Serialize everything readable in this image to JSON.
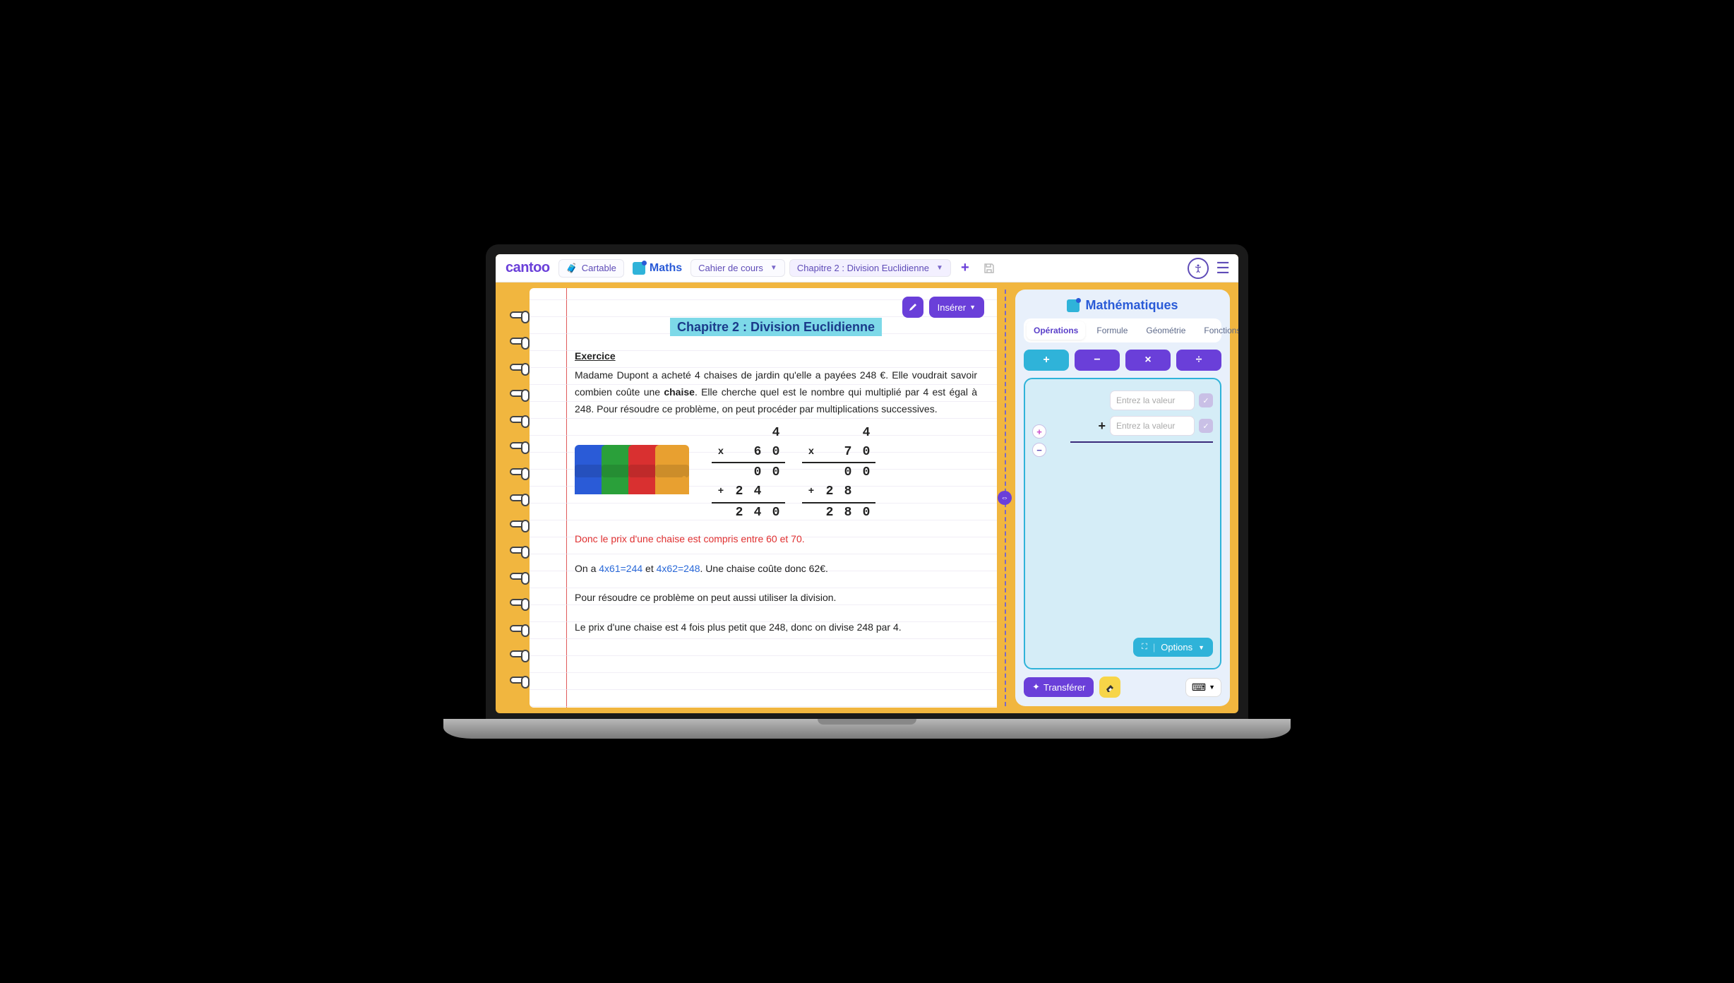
{
  "header": {
    "logo": "cantoo",
    "cartable": "Cartable",
    "subject": "Maths",
    "notebook_dd": "Cahier de cours",
    "chapter_dd": "Chapitre 2 : Division Euclidienne"
  },
  "page": {
    "insert_btn": "Insérer",
    "title": "Chapitre 2 : Division Euclidienne",
    "ex_heading": "Exercice",
    "ex_p1a": "Madame Dupont a acheté 4 chaises de jardin qu'elle a payées 248 €. Elle voudrait savoir combien coûte une ",
    "ex_p1b": "chaise",
    "ex_p1c": ". Elle cherche quel est le nombre qui multiplié par 4 est égal à 248. Pour résoudre ce problème, on peut procéder par multiplications successives.",
    "mult1": {
      "top": "4",
      "m1": "6",
      "m2": "0",
      "r1a": "0",
      "r1b": "0",
      "r2a": "2",
      "r2b": "4",
      "s1": "2",
      "s2": "4",
      "s3": "0"
    },
    "mult2": {
      "top": "4",
      "m1": "7",
      "m2": "0",
      "r1a": "0",
      "r1b": "0",
      "r2a": "2",
      "r2b": "8",
      "s1": "2",
      "s2": "8",
      "s3": "0"
    },
    "red_line": "Donc le prix d'une chaise est compris entre 60 et 70.",
    "line2a": "On a ",
    "link1": "4x61=244",
    "line2b": " et ",
    "link2": "4x62=248",
    "line2c": ". Une chaise coûte donc 62€.",
    "line3": "Pour résoudre ce problème on peut aussi utiliser la division.",
    "line4": "Le prix d'une chaise est 4 fois plus petit que 248, donc on divise 248 par 4."
  },
  "panel": {
    "title": "Mathématiques",
    "tabs": [
      "Opérations",
      "Formule",
      "Géométrie",
      "Fonctions"
    ],
    "placeholder": "Entrez la valeur",
    "options": "Options",
    "transfer": "Transférer"
  }
}
